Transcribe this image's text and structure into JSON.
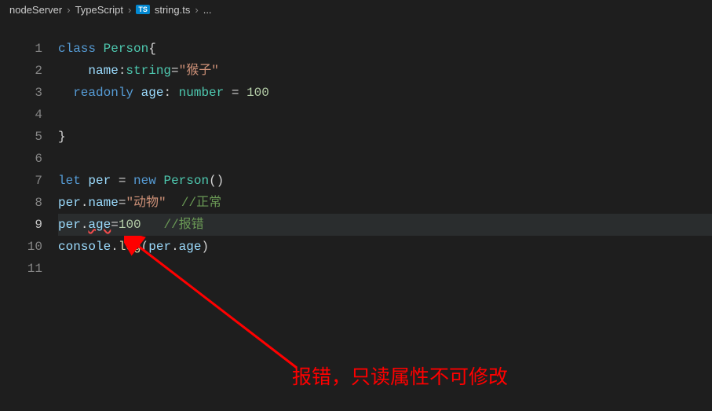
{
  "breadcrumb": {
    "item1": "nodeServer",
    "item2": "TypeScript",
    "fileIcon": "TS",
    "filename": "string.ts",
    "more": "..."
  },
  "lines": {
    "n1": "1",
    "n2": "2",
    "n3": "3",
    "n4": "4",
    "n5": "5",
    "n6": "6",
    "n7": "7",
    "n8": "8",
    "n9": "9",
    "n10": "10",
    "n11": "11"
  },
  "code": {
    "l1": {
      "kw": "class",
      "name": "Person",
      "brace": "{"
    },
    "l2": {
      "prop": "name",
      "colon": ":",
      "type": "string",
      "eq": "=",
      "str": "\"猴子\""
    },
    "l3": {
      "kw": "readonly",
      "prop": "age",
      "colon": ": ",
      "type": "number",
      "eq": " = ",
      "num": "100"
    },
    "l5": {
      "brace": "}"
    },
    "l7": {
      "kw": "let",
      "var": "per",
      "eq": " = ",
      "new": "new",
      "cls": "Person",
      "paren": "()"
    },
    "l8": {
      "obj": "per",
      "dot": ".",
      "prop": "name",
      "eq": "=",
      "str": "\"动物\"",
      "sp": "  ",
      "comment": "//正常"
    },
    "l9": {
      "obj": "per",
      "dot": ".",
      "prop": "age",
      "eq": "=",
      "num": "100",
      "sp": "   ",
      "comment": "//报错"
    },
    "l10": {
      "obj": "console",
      "dot": ".",
      "fn": "log",
      "open": "(",
      "arg1": "per",
      "dot2": ".",
      "arg2": "age",
      "close": ")"
    }
  },
  "annotation": "报错，只读属性不可修改"
}
